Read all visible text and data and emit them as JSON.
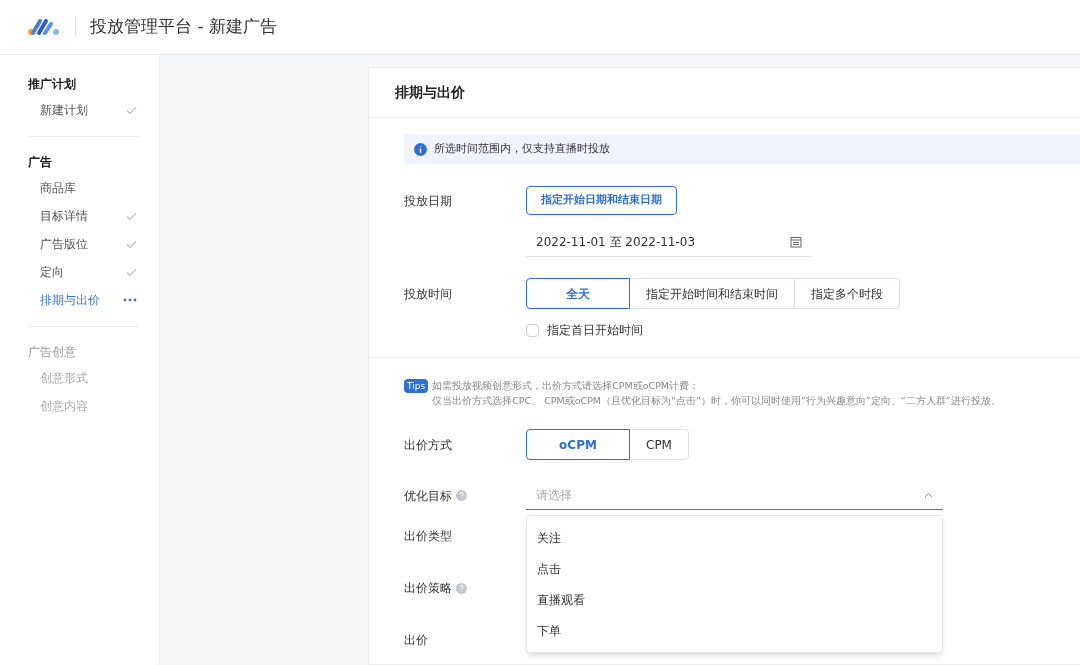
{
  "header": {
    "title": "投放管理平台 - 新建广告"
  },
  "sidebar": {
    "groups": [
      {
        "title": "推广计划",
        "disabled": false,
        "items": [
          {
            "label": "新建计划",
            "kind": "done",
            "selected": false
          }
        ]
      },
      {
        "title": "广告",
        "disabled": false,
        "items": [
          {
            "label": "商品库",
            "kind": "todo",
            "selected": false
          },
          {
            "label": "目标详情",
            "kind": "done",
            "selected": false
          },
          {
            "label": "广告版位",
            "kind": "done",
            "selected": false
          },
          {
            "label": "定向",
            "kind": "done",
            "selected": false
          },
          {
            "label": "排期与出价",
            "kind": "current",
            "selected": true
          }
        ]
      },
      {
        "title": "广告创意",
        "disabled": true,
        "items": [
          {
            "label": "创意形式",
            "kind": "todo",
            "selected": false
          },
          {
            "label": "创意内容",
            "kind": "todo",
            "selected": false
          }
        ]
      }
    ]
  },
  "section": {
    "title": "排期与出价",
    "notice": "所选时间范围内，仅支持直播时投放",
    "date": {
      "label": "投放日期",
      "button": "指定开始日期和结束日期",
      "value": "2022-11-01 至 2022-11-03"
    },
    "time": {
      "label": "投放时间",
      "options": [
        {
          "label": "全天",
          "selected": true
        },
        {
          "label": "指定开始时间和结束时间",
          "selected": false
        },
        {
          "label": "指定多个时段",
          "selected": false
        }
      ],
      "checkbox": {
        "label": "指定首日开始时间",
        "checked": false
      }
    },
    "tips": {
      "badge": "Tips",
      "lines": [
        "如需投放视频创意形式，出价方式请选择CPM或oCPM计费；",
        "仅当出价方式选择CPC、 CPM或oCPM（且优化目标为“点击”）时，你可以同时使用“行为兴趣意向”定向、“二方人群”进行投放。"
      ]
    },
    "bid_method": {
      "label": "出价方式",
      "options": [
        {
          "label": "oCPM",
          "selected": true
        },
        {
          "label": "CPM",
          "selected": false
        }
      ]
    },
    "goal": {
      "label": "优化目标",
      "help": true,
      "placeholder": "请选择",
      "expanded": true,
      "options": [
        "关注",
        "点击",
        "直播观看",
        "下单"
      ]
    },
    "more_fields": [
      {
        "label": "出价类型",
        "help": false
      },
      {
        "label": "出价策略",
        "help": true
      },
      {
        "label": "出价",
        "help": false
      }
    ]
  }
}
